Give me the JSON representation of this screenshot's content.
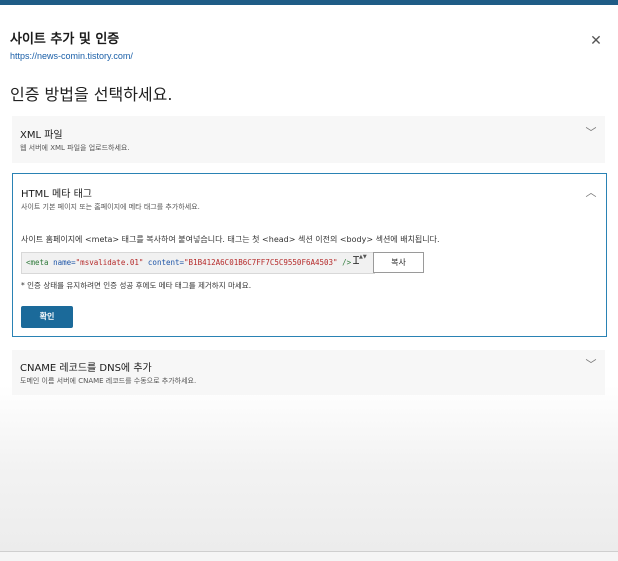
{
  "dialog": {
    "title": "사이트 추가 및 인증",
    "url": "https://news-comin.tistory.com/",
    "close_glyph": "✕",
    "heading": "인증 방법을 선택하세요."
  },
  "methods": {
    "xml": {
      "title": "XML 파일",
      "description": "웹 서버에 XML 파일을 업로드하세요.",
      "chevron": "﹀"
    },
    "html": {
      "title": "HTML 메타 태그",
      "description": "사이트 기본 페이지 또는 홈페이지에 메타 태그를 추가하세요.",
      "chevron": "︿",
      "instruction": "사이트 홈페이지에 <meta> 태그를 복사하여 붙여넣습니다. 태그는 첫 <head> 섹션 이전의 <body> 섹션에 배치됩니다.",
      "code_open": "<meta",
      "code_name_attr": "name=",
      "code_name_val": "\"msvalidate.01\"",
      "code_content_attr": "content=",
      "code_content_val": "\"B1B412A6C01B6C7FF7C5C9550F6A4503\"",
      "code_close": "/>",
      "copy_label": "복사",
      "note": "* 인증 상태를 유지하려면 인증 성공 후에도 메타 태그를 제거하지 마세요.",
      "confirm_label": "확인"
    },
    "cname": {
      "title": "CNAME 레코드를 DNS에 추가",
      "description": "도메인 이름 서버에 CNAME 레코드를 수동으로 추가하세요.",
      "chevron": "﹀"
    }
  },
  "icons": {
    "text_cursor": "Ɪ",
    "spinner": "▲▼"
  },
  "colors": {
    "accent": "#1b6a9a",
    "panel_border": "#2a82b4",
    "url": "#1a5fa8"
  }
}
